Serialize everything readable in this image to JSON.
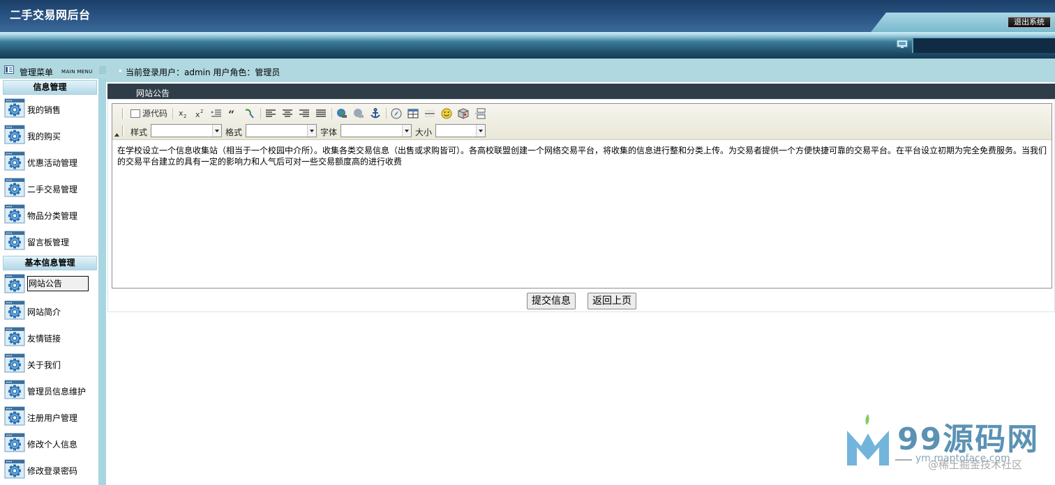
{
  "header": {
    "app_title": "二手交易网后台",
    "logout_label": "退出系统"
  },
  "subbar": {
    "menu_title": "管理菜单",
    "menu_title_en": "MAIN MENU",
    "user_info": "当前登录用户：admin  用户角色：管理员"
  },
  "sidebar": {
    "sections": [
      {
        "title": "信息管理",
        "items": [
          "我的销售",
          "我的购买",
          "优惠活动管理",
          "二手交易管理",
          "物品分类管理",
          "留言板管理"
        ]
      },
      {
        "title": "基本信息管理",
        "items": [
          "网站公告",
          "网站简介",
          "友情链接",
          "关于我们",
          "管理员信息维护",
          "注册用户管理",
          "修改个人信息",
          "修改登录密码"
        ]
      }
    ],
    "active_item": "网站公告"
  },
  "panel": {
    "title": "网站公告"
  },
  "editor": {
    "source_label": "源代码",
    "combo_labels": {
      "style": "样式",
      "format": "格式",
      "font": "字体",
      "size": "大小"
    },
    "content": "在学校设立一个信息收集站（相当于一个校园中介所）。收集各类交易信息（出售或求购皆可）。各高校联盟创建一个网络交易平台，将收集的信息进行整和分类上传。为交易者提供一个方便快捷可靠的交易平台。在平台设立初期为完全免费服务。当我们的交易平台建立的具有一定的影响力和人气后可对一些交易额度高的进行收费"
  },
  "actions": {
    "submit_label": "提交信息",
    "back_label": "返回上页"
  },
  "watermark": {
    "brand": "99源码网",
    "url": "ym.maptoface.com",
    "credit": "@稀土掘金技术社区"
  },
  "colors": {
    "header_dark": "#1b3f68",
    "subbar_bg": "#afd8e0",
    "panel_head": "#2e3d47"
  }
}
